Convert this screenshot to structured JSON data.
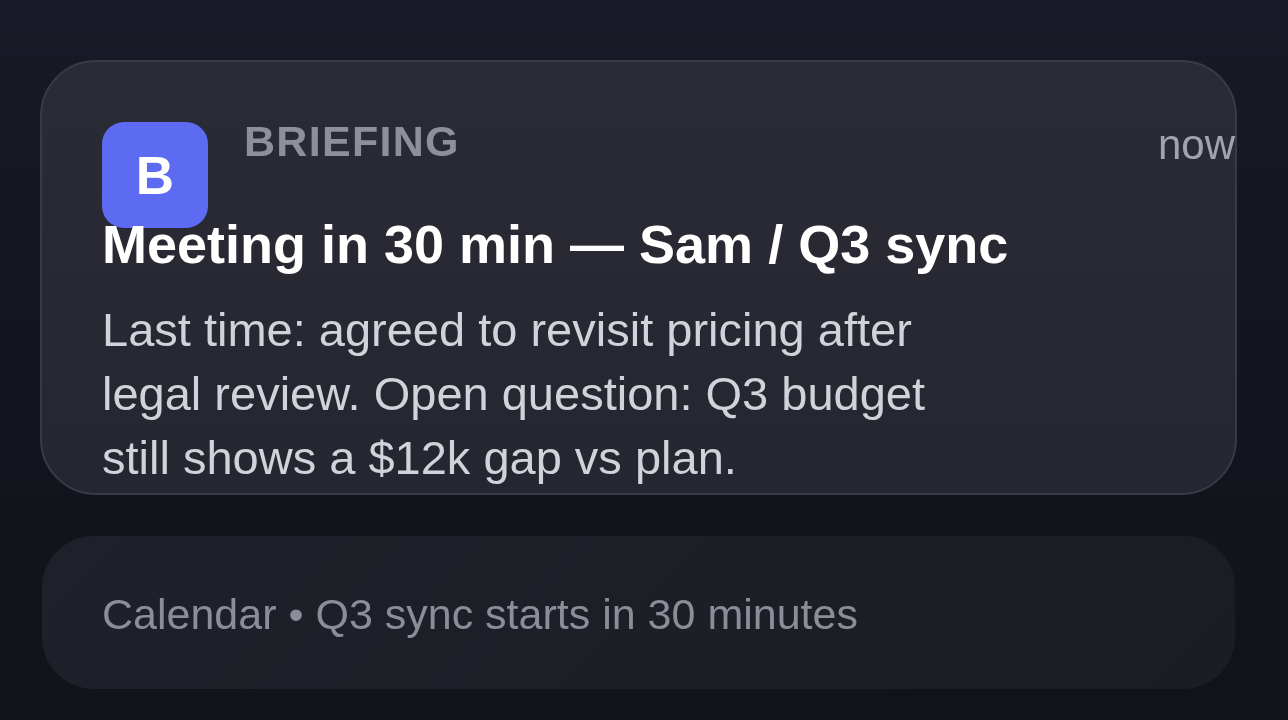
{
  "notification": {
    "app_icon_letter": "B",
    "app_name": "BRIEFING",
    "time": "now",
    "title": "Meeting in 30 min — Sam / Q3 sync",
    "body": "Last time: agreed to revisit pricing after legal review. Open question: Q3 budget still shows a $12k gap vs plan."
  },
  "secondary_notification": {
    "text": "Calendar • Q3 sync starts in 30 minutes"
  }
}
